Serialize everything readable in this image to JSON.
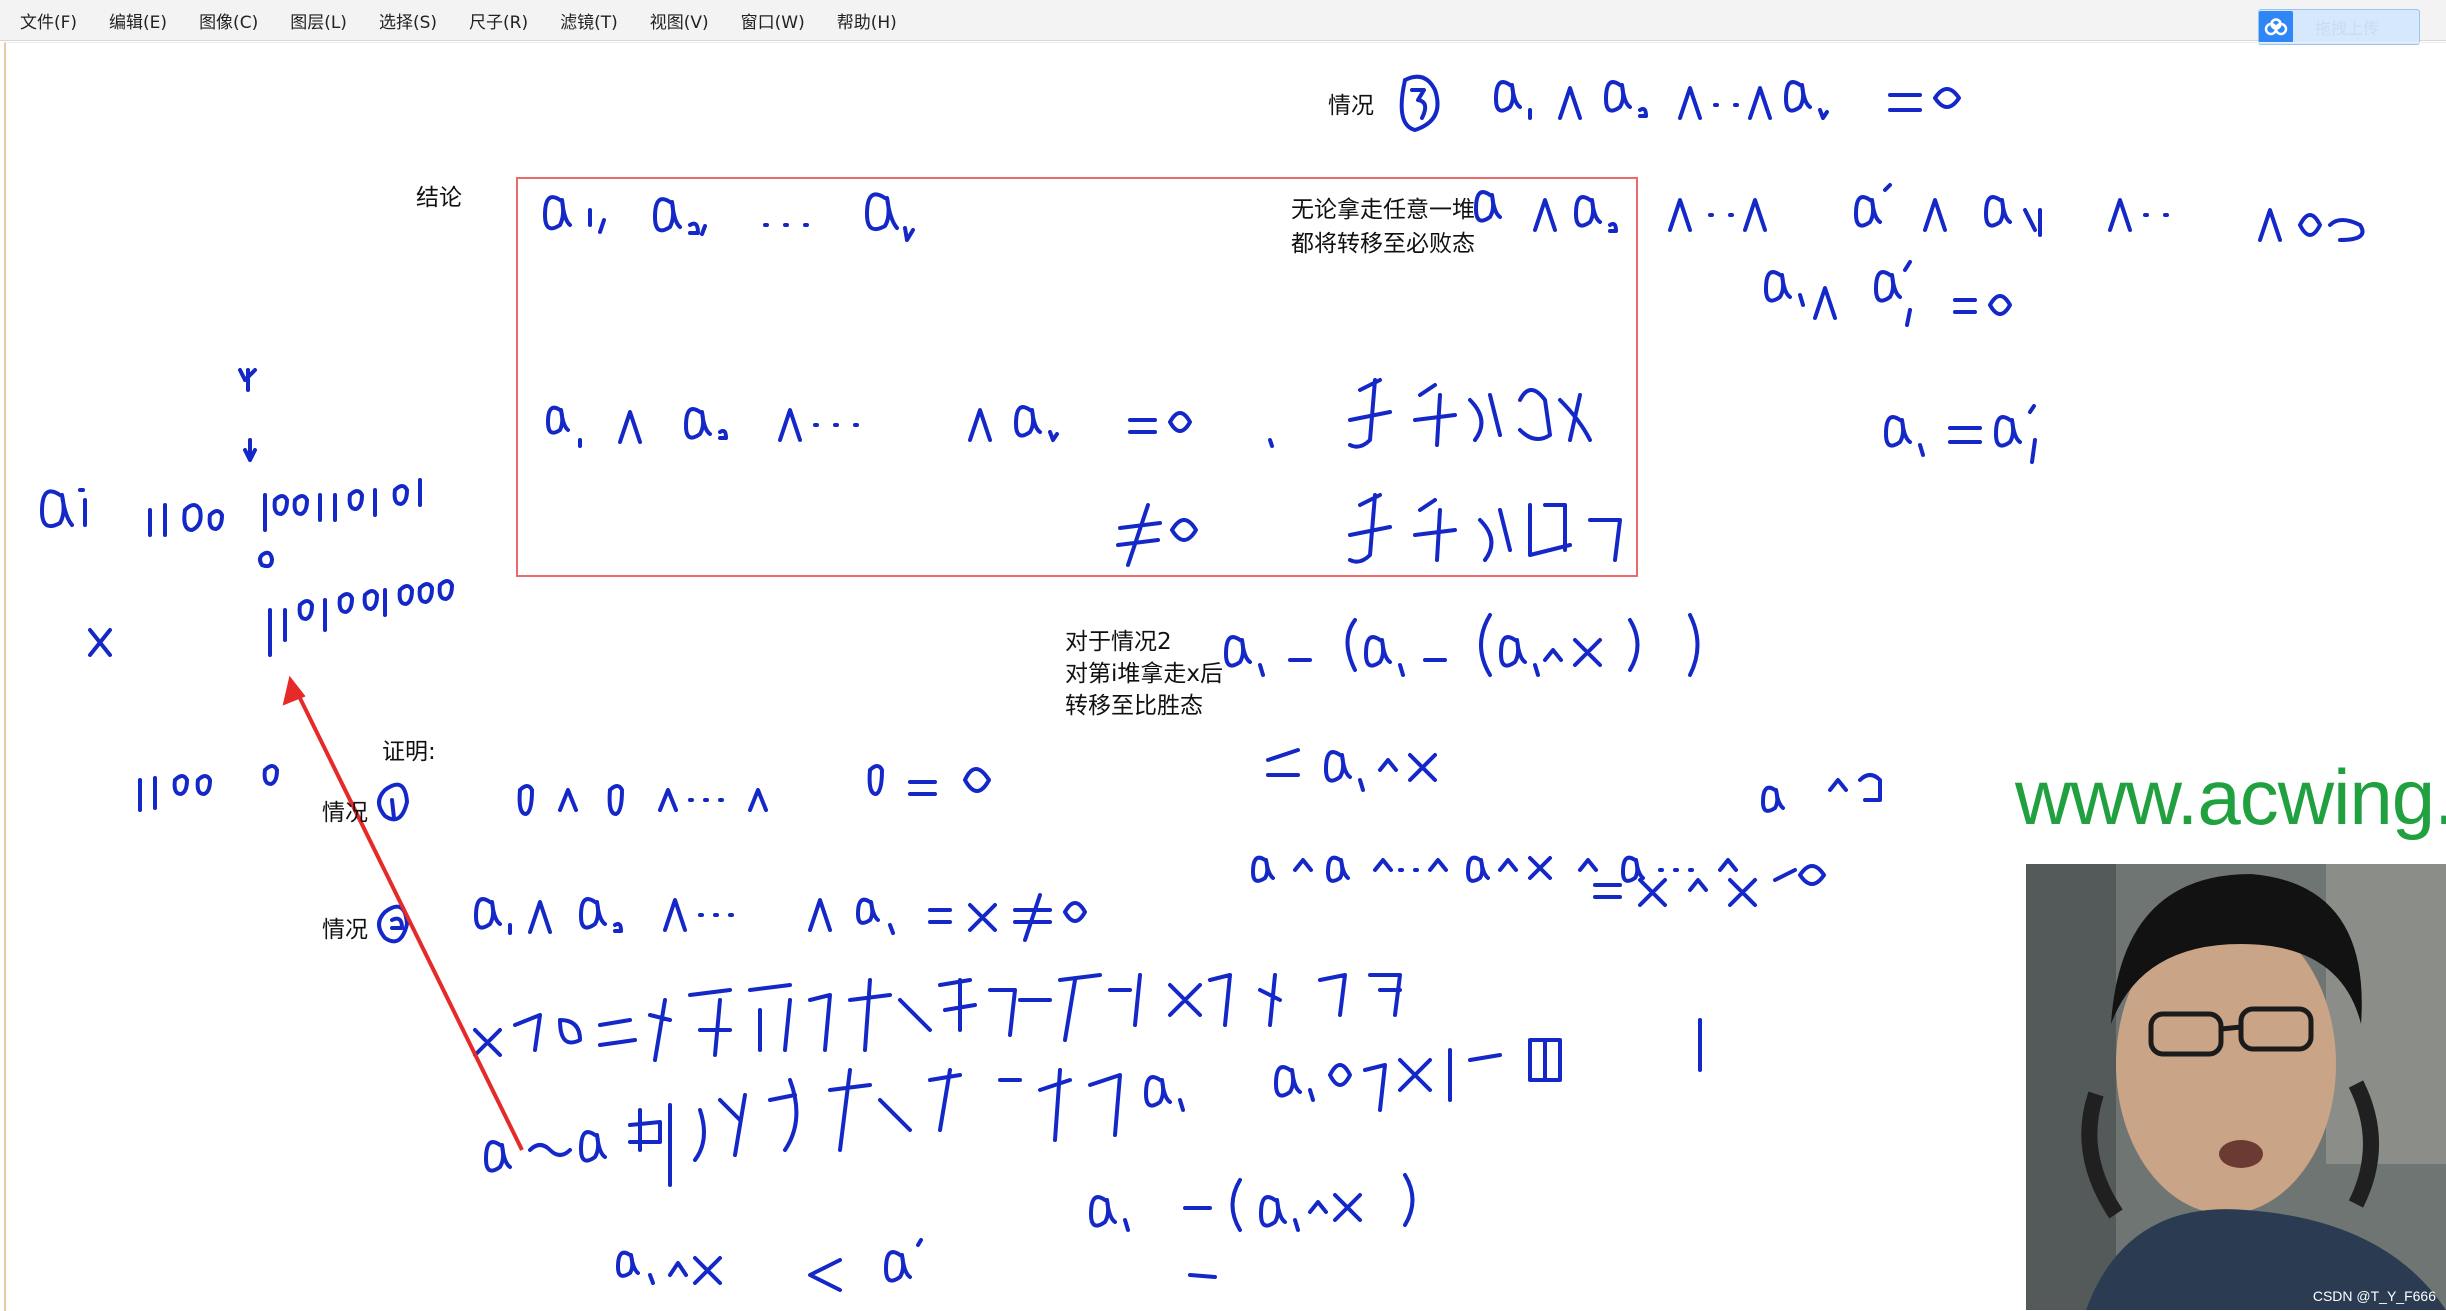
{
  "menu": {
    "items": [
      "文件(F)",
      "编辑(E)",
      "图像(C)",
      "图层(L)",
      "选择(S)",
      "尺子(R)",
      "滤镜(T)",
      "视图(V)",
      "窗口(W)",
      "帮助(H)"
    ]
  },
  "upload": {
    "label": "拖拽上传"
  },
  "whiteboard": {
    "conclusion_label": "结论",
    "note_any_move_line1": "无论拿走任意一堆",
    "note_any_move_line2": "都将转移至必败态",
    "case2_note_line1": "对于情况2",
    "case2_note_line2": "对第i堆拿走x后",
    "case2_note_line3": "转移至比胜态",
    "proof_label": "证明:",
    "case1_label": "情况",
    "case2_label": "情况",
    "case3_label": "情况"
  },
  "watermark": {
    "text": "www.acwing.c"
  },
  "credit": {
    "text": "CSDN @T_Y_F666"
  },
  "colors": {
    "ink": "#1428c8",
    "box": "#ec6a6a",
    "arrow": "#e62a2a",
    "watermark": "#21a040",
    "upload_accent": "#2f86f6"
  }
}
